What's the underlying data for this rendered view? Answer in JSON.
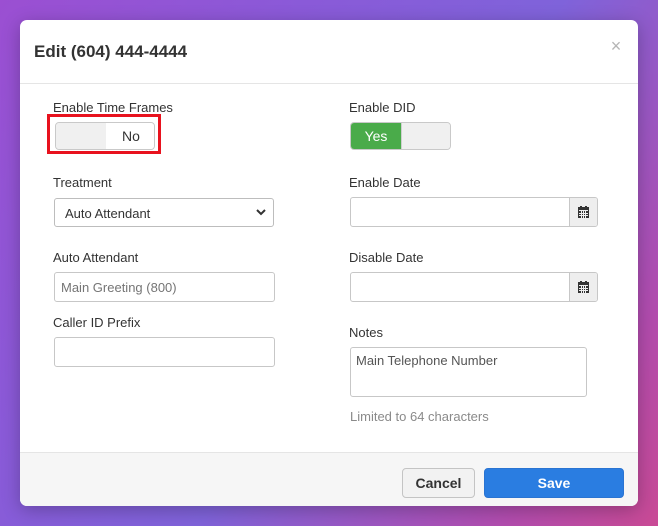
{
  "dialog": {
    "title": "Edit (604) 444-4444",
    "close_icon": "×"
  },
  "left": {
    "time_frames_label": "Enable Time Frames",
    "time_frames_toggle": {
      "state": "off",
      "off_text": "No"
    },
    "treatment_label": "Treatment",
    "treatment_selected": "Auto Attendant",
    "auto_attendant_label": "Auto Attendant",
    "auto_attendant_placeholder": "Main Greeting (800)",
    "caller_id_prefix_label": "Caller ID Prefix",
    "caller_id_prefix_value": ""
  },
  "right": {
    "enable_did_label": "Enable DID",
    "enable_did_toggle": {
      "state": "on",
      "on_text": "Yes"
    },
    "enable_date_label": "Enable Date",
    "enable_date_value": "",
    "disable_date_label": "Disable Date",
    "disable_date_value": "",
    "notes_label": "Notes",
    "notes_value": "Main Telephone Number",
    "notes_hint": "Limited to 64 characters"
  },
  "footer": {
    "cancel_label": "Cancel",
    "save_label": "Save"
  },
  "colors": {
    "toggle_on": "#4aab4a",
    "primary_button": "#2a7de1",
    "highlight_box": "#e8121e"
  },
  "icons": {
    "calendar": "calendar-icon",
    "select_arrow": "chevron-down-icon",
    "close": "close-icon"
  }
}
